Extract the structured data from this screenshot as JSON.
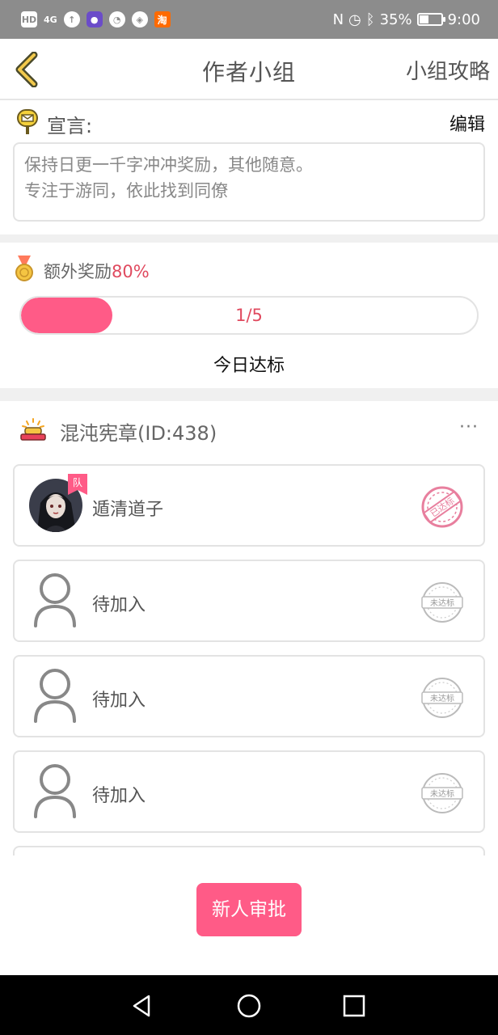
{
  "status_bar": {
    "left_icons": [
      "hd-icon",
      "signal-icon",
      "data-saver-icon",
      "app-icon",
      "wechat-icon",
      "wallet-icon",
      "taobao-icon"
    ],
    "hd_label": "HD",
    "signal_label": "4G",
    "taobao_label": "淘",
    "battery": "35%",
    "time": "9:00"
  },
  "header": {
    "title": "作者小组",
    "right_link": "小组攻略"
  },
  "declaration": {
    "label": "宣言:",
    "edit": "编辑",
    "lines": [
      "保持日更一千字冲冲奖励，其他随意。",
      "专注于游同，依此找到同僚"
    ]
  },
  "bonus": {
    "label": "额外奖励",
    "percent": "80%",
    "progress_text": "1/5",
    "progress_fraction": 0.2,
    "reached_label": "今日达标"
  },
  "team": {
    "name": "混沌宪章(ID:438)",
    "more": "···",
    "captain_tag": "队",
    "members": [
      {
        "name": "遁清道子",
        "stamp": "已达标",
        "has_avatar": true
      },
      {
        "name": "待加入",
        "stamp": "未达标",
        "has_avatar": false
      },
      {
        "name": "待加入",
        "stamp": "未达标",
        "has_avatar": false
      },
      {
        "name": "待加入",
        "stamp": "未达标",
        "has_avatar": false
      }
    ]
  },
  "approve_button": "新人审批",
  "colors": {
    "accent": "#ff5b87",
    "accent_text": "#e04a5f",
    "status_bar": "#8c8c8c"
  }
}
